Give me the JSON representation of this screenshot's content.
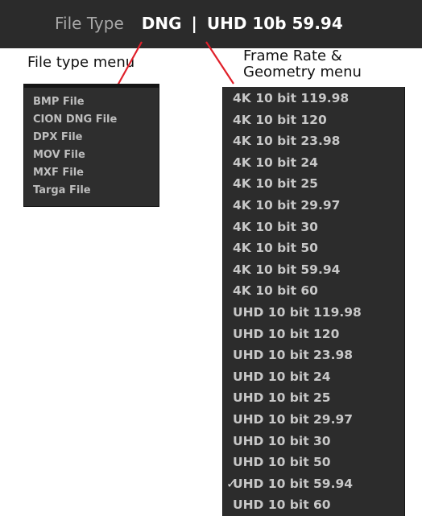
{
  "top_bar": {
    "file_type_label": "File Type",
    "file_type_value": "DNG",
    "separator": "|",
    "format_value": "UHD 10b 59.94"
  },
  "annotations": {
    "file_type_menu": "File type menu",
    "frame_rate_menu_line1": "Frame Rate &",
    "frame_rate_menu_line2": "Geometry menu"
  },
  "file_type_menu": {
    "items": [
      "BMP File",
      "CION DNG File",
      "DPX File",
      "MOV File",
      "MXF File",
      "Targa File"
    ]
  },
  "frame_rate_menu": {
    "items": [
      "4K 10 bit 119.98",
      "4K 10 bit 120",
      "4K 10 bit 23.98",
      "4K 10 bit 24",
      "4K 10 bit 25",
      "4K 10 bit 29.97",
      "4K 10 bit 30",
      "4K 10 bit 50",
      "4K 10 bit 59.94",
      "4K 10 bit 60",
      "UHD 10 bit 119.98",
      "UHD 10 bit 120",
      "UHD 10 bit 23.98",
      "UHD 10 bit 24",
      "UHD 10 bit 25",
      "UHD 10 bit 29.97",
      "UHD 10 bit 30",
      "UHD 10 bit 50",
      "UHD 10 bit 59.94",
      "UHD 10 bit 60"
    ],
    "selected": "UHD 10 bit 59.94",
    "check_mark": "✓"
  },
  "colors": {
    "bar_background": "#2b2b2b",
    "menu_background": "#2c2c2c",
    "leader_line": "#e0202a"
  }
}
